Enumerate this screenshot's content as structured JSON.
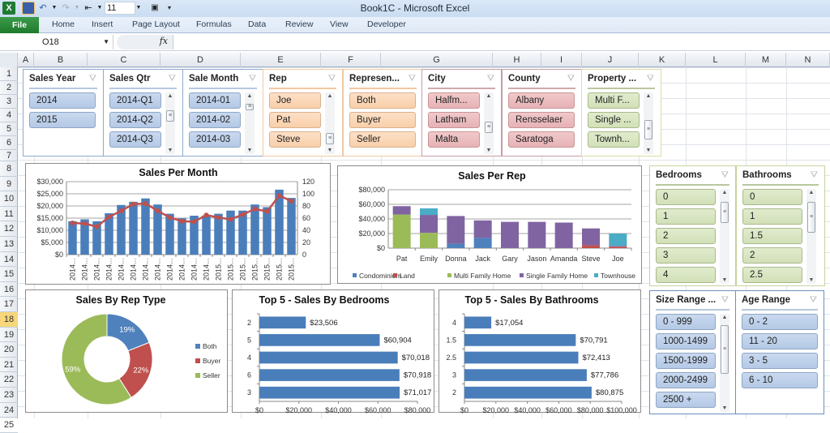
{
  "window": {
    "title": "Book1C  -  Microsoft Excel"
  },
  "quick_access": {
    "font_size": "11"
  },
  "ribbon": {
    "tabs": [
      "File",
      "Home",
      "Insert",
      "Page Layout",
      "Formulas",
      "Data",
      "Review",
      "View",
      "Developer"
    ]
  },
  "formula_bar": {
    "name_box": "O18",
    "fx_label": "fx",
    "formula": ""
  },
  "columns": [
    "A",
    "B",
    "C",
    "D",
    "E",
    "F",
    "G",
    "H",
    "I",
    "J",
    "K",
    "L",
    "M",
    "N"
  ],
  "rows": [
    "1",
    "2",
    "3",
    "4",
    "5",
    "6",
    "7",
    "8",
    "9",
    "10",
    "11",
    "12",
    "13",
    "14",
    "15",
    "16",
    "17",
    "18",
    "19",
    "20",
    "21",
    "22",
    "23",
    "24",
    "25"
  ],
  "selected_row": "18",
  "slicers": [
    {
      "title": "Sales Year",
      "items": [
        "2014",
        "2015"
      ]
    },
    {
      "title": "Sales Qtr",
      "items": [
        "2014-Q1",
        "2014-Q2",
        "2014-Q3"
      ]
    },
    {
      "title": "Sale Month",
      "items": [
        "2014-01",
        "2014-02",
        "2014-03"
      ]
    },
    {
      "title": "Rep",
      "items": [
        "Joe",
        "Pat",
        "Steve"
      ]
    },
    {
      "title": "Represen...",
      "items": [
        "Both",
        "Buyer",
        "Seller"
      ]
    },
    {
      "title": "City",
      "items": [
        "Halfm...",
        "Latham",
        "Malta"
      ]
    },
    {
      "title": "County",
      "items": [
        "Albany",
        "Rensselaer",
        "Saratoga"
      ]
    },
    {
      "title": "Property ...",
      "items": [
        "Multi F...",
        "Single ...",
        "Townh..."
      ]
    },
    {
      "title": "Bedrooms",
      "items": [
        "0",
        "1",
        "2",
        "3",
        "4"
      ]
    },
    {
      "title": "Bathrooms",
      "items": [
        "0",
        "1",
        "1.5",
        "2",
        "2.5"
      ]
    },
    {
      "title": "Size Range ...",
      "items": [
        "0 - 999",
        "1000-1499",
        "1500-1999",
        "2000-2499",
        "2500 +"
      ]
    },
    {
      "title": "Age Range",
      "items": [
        "0 - 2",
        "11 - 20",
        "3 - 5",
        "6 - 10"
      ]
    }
  ],
  "chart_data": [
    {
      "type": "bar",
      "title": "Sales Per Month",
      "categories": [
        "2014...",
        "2014...",
        "2014...",
        "2014...",
        "2014...",
        "2014...",
        "2014...",
        "2014...",
        "2014...",
        "2014...",
        "2014...",
        "2014...",
        "2015...",
        "2015...",
        "2015...",
        "2015...",
        "2015...",
        "2015...",
        "2015..."
      ],
      "series": [
        {
          "name": "Sales",
          "kind": "bar",
          "axis": "left",
          "color": "#4a7ebb",
          "values": [
            13700,
            14500,
            13700,
            17000,
            20400,
            21700,
            23100,
            20600,
            16800,
            14900,
            16000,
            16100,
            16800,
            18100,
            18100,
            20600,
            19500,
            26700,
            23300
          ]
        },
        {
          "name": "Count",
          "kind": "line",
          "axis": "right",
          "color": "#c0504d",
          "values": [
            52,
            51,
            46,
            62,
            72,
            83,
            84,
            72,
            61,
            55,
            54,
            65,
            61,
            58,
            66,
            75,
            71,
            97,
            88
          ]
        }
      ],
      "ylim": [
        0,
        30000
      ],
      "yticks": [
        "$0",
        "$5,000",
        "$10,000",
        "$15,000",
        "$20,000",
        "$25,000",
        "$30,000"
      ],
      "y2lim": [
        0,
        120
      ],
      "y2ticks": [
        "0",
        "20",
        "40",
        "60",
        "80",
        "100",
        "120"
      ],
      "grid": true
    },
    {
      "type": "bar",
      "stacked": true,
      "title": "Sales Per Rep",
      "categories": [
        "Pat",
        "Emily",
        "Donna",
        "Jack",
        "Gary",
        "Jason",
        "Amanda",
        "Steve",
        "Joe"
      ],
      "series": [
        {
          "name": "Condominium",
          "color": "#4f81bd",
          "values": [
            0,
            0,
            6000,
            14000,
            0,
            0,
            0,
            0,
            0
          ]
        },
        {
          "name": "Land",
          "color": "#c0504d",
          "values": [
            0,
            0,
            0,
            0,
            0,
            0,
            0,
            4000,
            2000
          ]
        },
        {
          "name": "Multi Family Home",
          "color": "#9bbb59",
          "values": [
            46000,
            21000,
            0,
            0,
            0,
            0,
            0,
            0,
            0
          ]
        },
        {
          "name": "Single Family Home",
          "color": "#8064a2",
          "values": [
            11500,
            24500,
            38000,
            24000,
            36000,
            36000,
            35000,
            23000,
            1000
          ]
        },
        {
          "name": "Townhouse",
          "color": "#4bacc6",
          "values": [
            0,
            9000,
            0,
            0,
            0,
            0,
            0,
            0,
            17000
          ]
        }
      ],
      "ylim": [
        0,
        80000
      ],
      "yticks": [
        "$0",
        "$20,000",
        "$40,000",
        "$60,000",
        "$80,000"
      ],
      "legend": "bottom",
      "grid": true
    },
    {
      "type": "pie",
      "donut": true,
      "title": "Sales By Rep Type",
      "categories": [
        "Both",
        "Buyer",
        "Seller"
      ],
      "values": [
        19,
        22,
        59
      ],
      "labels": [
        "19%",
        "22%",
        "59%"
      ],
      "colors": [
        "#4f81bd",
        "#c0504d",
        "#9bbb59"
      ],
      "legend": "right"
    },
    {
      "type": "bar",
      "orientation": "horizontal",
      "title": "Top 5 - Sales By Bedrooms",
      "categories": [
        "2",
        "5",
        "4",
        "6",
        "3"
      ],
      "values": [
        23506,
        60904,
        70018,
        70918,
        71017
      ],
      "labels": [
        "$23,506",
        "$60,904",
        "$70,018",
        "$70,918",
        "$71,017"
      ],
      "xlim": [
        0,
        80000
      ],
      "xticks": [
        "$0",
        "$20,000",
        "$40,000",
        "$60,000",
        "$80,000"
      ]
    },
    {
      "type": "bar",
      "orientation": "horizontal",
      "title": "Top 5 - Sales By Bathrooms",
      "categories": [
        "4",
        "1.5",
        "2.5",
        "3",
        "2"
      ],
      "values": [
        17054,
        70791,
        72413,
        77786,
        80875
      ],
      "labels": [
        "$17,054",
        "$70,791",
        "$72,413",
        "$77,786",
        "$80,875"
      ],
      "xlim": [
        0,
        100000
      ],
      "xticks": [
        "$0",
        "$20,000",
        "$40,000",
        "$60,000",
        "$80,000",
        "$100,000"
      ]
    }
  ]
}
